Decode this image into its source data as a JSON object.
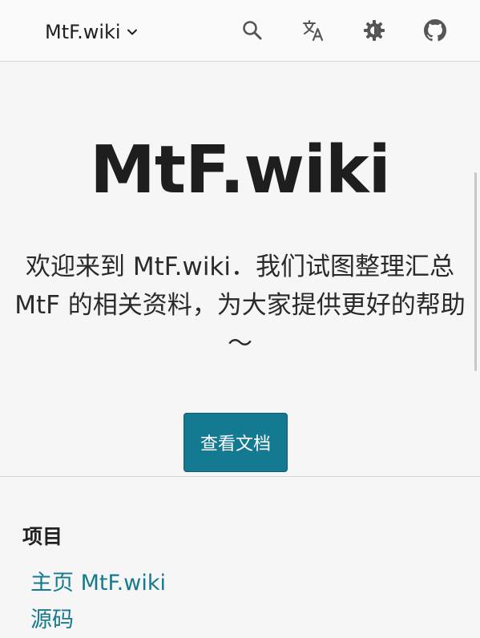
{
  "header": {
    "brand": "MtF.wiki",
    "icons": [
      "chevron-down-icon",
      "search-icon",
      "translate-icon",
      "theme-toggle-icon",
      "github-icon"
    ]
  },
  "hero": {
    "title": "MtF.wiki",
    "description": "欢迎来到 MtF.wiki．我们试图整理汇总 MtF 的相关资料，为大家提供更好的帮助～",
    "cta_label": "查看文档"
  },
  "footer": {
    "heading": "项目",
    "links": [
      {
        "label": "主页 MtF.wiki"
      },
      {
        "label": "源码"
      }
    ]
  },
  "colors": {
    "accent": "#137a92",
    "link": "#167a8e",
    "background": "#f6f6f7",
    "header_bg": "#fafafa"
  }
}
